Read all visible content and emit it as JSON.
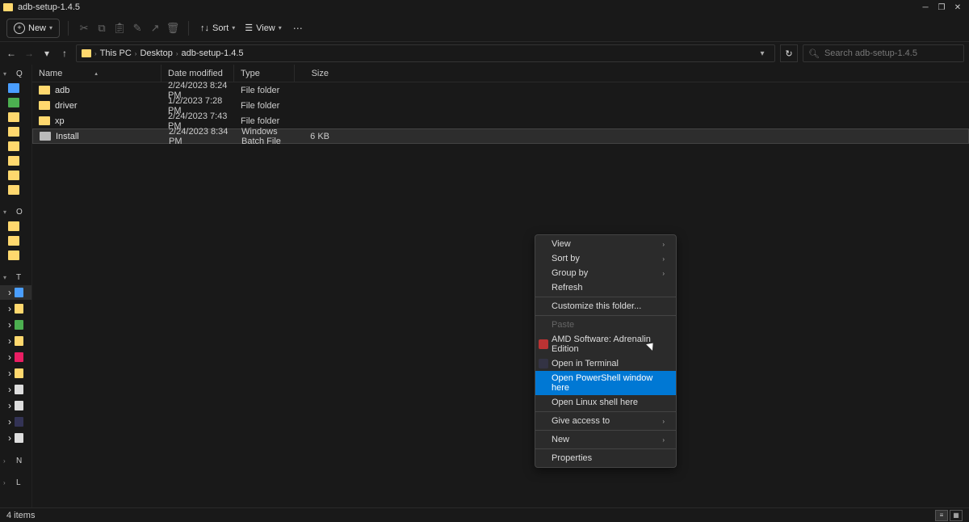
{
  "window": {
    "title": "adb-setup-1.4.5"
  },
  "toolbar": {
    "new_label": "New",
    "sort_label": "Sort",
    "view_label": "View"
  },
  "breadcrumb": {
    "root": "This PC",
    "mid": "Desktop",
    "leaf": "adb-setup-1.4.5"
  },
  "search": {
    "placeholder": "Search adb-setup-1.4.5"
  },
  "columns": {
    "name": "Name",
    "date": "Date modified",
    "type": "Type",
    "size": "Size"
  },
  "files": [
    {
      "name": "adb",
      "date": "2/24/2023 8:24 PM",
      "type": "File folder",
      "size": "",
      "icon": "folder"
    },
    {
      "name": "driver",
      "date": "1/2/2023 7:28 PM",
      "type": "File folder",
      "size": "",
      "icon": "folder"
    },
    {
      "name": "xp",
      "date": "2/24/2023 7:43 PM",
      "type": "File folder",
      "size": "",
      "icon": "folder"
    },
    {
      "name": "Install",
      "date": "2/24/2023 8:34 PM",
      "type": "Windows Batch File",
      "size": "6 KB",
      "icon": "batch"
    }
  ],
  "sidebar": {
    "quick_label": "Q",
    "onedrive_label": "O",
    "thispc_label": "T",
    "network_label": "N",
    "linux_label": "L"
  },
  "context_menu": {
    "view": "View",
    "sort_by": "Sort by",
    "group_by": "Group by",
    "refresh": "Refresh",
    "customize": "Customize this folder...",
    "paste": "Paste",
    "amd": "AMD Software: Adrenalin Edition",
    "terminal": "Open in Terminal",
    "powershell": "Open PowerShell window here",
    "linux_shell": "Open Linux shell here",
    "give_access": "Give access to",
    "new": "New",
    "properties": "Properties"
  },
  "status": {
    "items": "4 items"
  }
}
